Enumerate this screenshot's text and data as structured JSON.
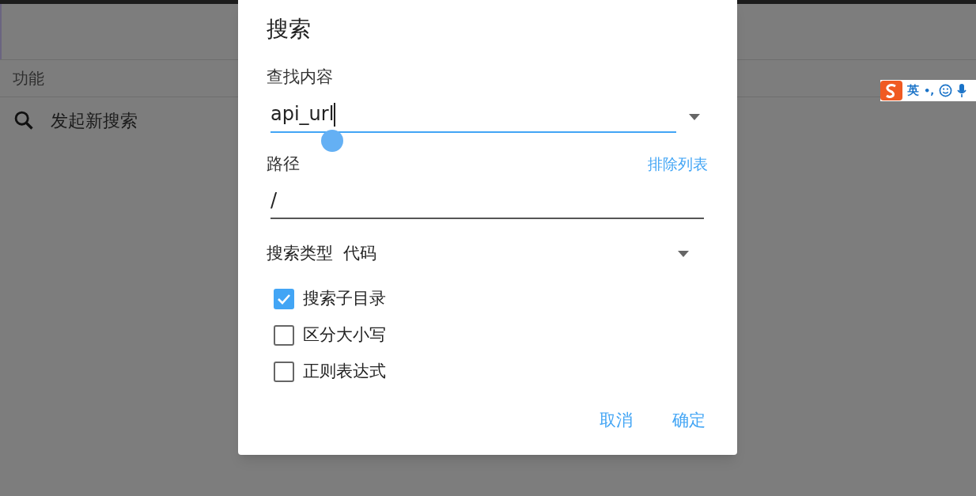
{
  "background": {
    "section_header": "功能",
    "items": [
      {
        "label": "发起新搜索"
      }
    ]
  },
  "dialog": {
    "title": "搜索",
    "query": {
      "label": "查找内容",
      "value": "api_url",
      "focused": true
    },
    "path": {
      "label": "路径",
      "value": "/",
      "focused": false,
      "link": "排除列表"
    },
    "search_type": {
      "label": "搜索类型",
      "value": "代码"
    },
    "options": [
      {
        "label": "搜索子目录",
        "checked": true
      },
      {
        "label": "区分大小写",
        "checked": false
      },
      {
        "label": "正则表达式",
        "checked": false
      }
    ],
    "buttons": [
      {
        "label": "取消"
      },
      {
        "label": "确定"
      }
    ]
  },
  "ime_bar": {
    "mode": "英",
    "punctuation": "•,"
  }
}
